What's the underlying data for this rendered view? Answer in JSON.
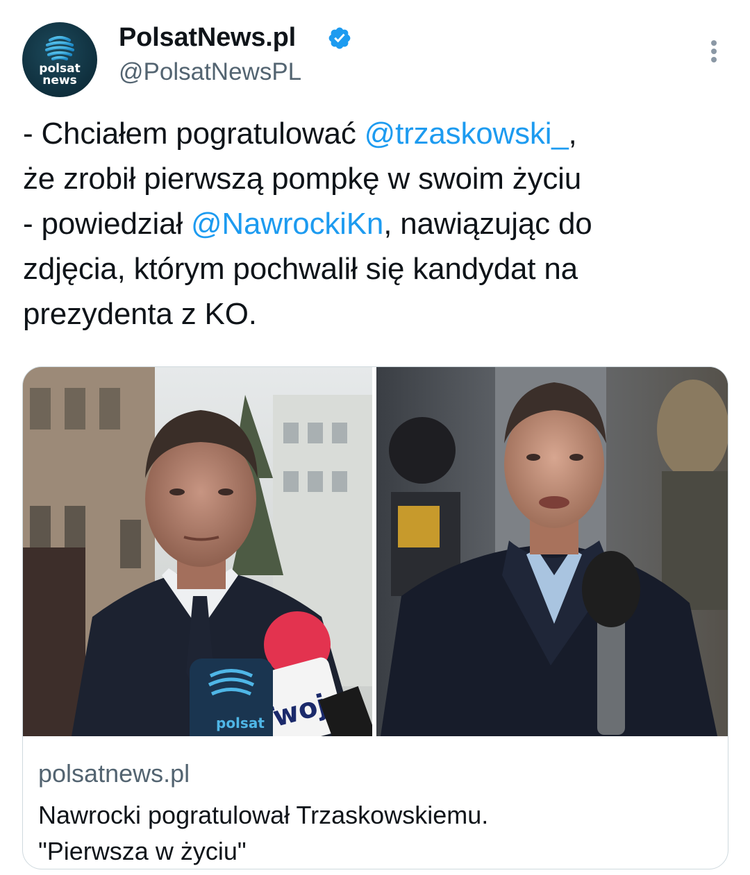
{
  "author": {
    "avatar_label_line1": "polsat",
    "avatar_label_line2": "news",
    "name": "PolsatNews.pl",
    "handle": "@PolsatNewsPL",
    "verified": true,
    "verified_color": "#1d9bf0"
  },
  "more_icon": "more-vertical-icon",
  "tweet": {
    "lines": [
      [
        {
          "text": "- Chciałem pogratulować "
        },
        {
          "text": "@trzaskowski_",
          "mention": true
        },
        {
          "text": ","
        }
      ],
      [
        {
          "text": "że zrobił pierwszą pompkę w swoim życiu"
        }
      ],
      [
        {
          "text": "- powiedział "
        },
        {
          "text": "@NawrockiKn",
          "mention": true
        },
        {
          "text": ", nawiązując do"
        }
      ],
      [
        {
          "text": "zdjęcia, którym pochwalił się kandydat na"
        }
      ],
      [
        {
          "text": "prezydenta z KO."
        }
      ]
    ],
    "mention_color": "#1d9bf0"
  },
  "card": {
    "image_alt": "Two men in dark coats speaking into microphones",
    "mic_left_label": "polsat news",
    "mic_right_label": "Twoje radio",
    "domain": "polsatnews.pl",
    "title_line1": "Nawrocki pogratulował Trzaskowskiemu.",
    "title_line2": "\"Pierwsza w życiu\""
  },
  "colors": {
    "text_primary": "#0f1419",
    "text_secondary": "#536471",
    "border": "#cfd9de"
  }
}
